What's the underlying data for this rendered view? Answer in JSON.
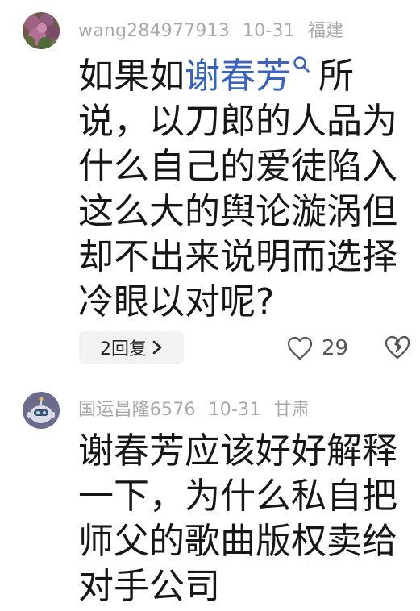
{
  "comments": [
    {
      "username": "wang284977913",
      "date": "10-31",
      "location": "福建",
      "text_before_mention": "如果如",
      "mention": "谢春芳",
      "text_after_mention": "所说，以刀郎的人品为什么自己的爱徒陷入这么大的舆论漩涡但却不出来说明而选择冷眼以对呢?",
      "reply_label": "2回复",
      "like_count": "29",
      "icons": [
        "avatar-flowers",
        "search-icon",
        "chevron-right-icon",
        "heart-icon",
        "broken-heart-icon"
      ]
    },
    {
      "username": "国运昌隆6576",
      "date": "10-31",
      "location": "甘肃",
      "text": "谢春芳应该好好解释一下，为什么私自把师父的歌曲版权卖给对手公司",
      "icons": [
        "avatar-robot"
      ]
    }
  ],
  "colors": {
    "meta": "#a9a9a9",
    "body": "#161616",
    "mention": "#3a64b8",
    "reply_bg": "#f2f2f2"
  }
}
